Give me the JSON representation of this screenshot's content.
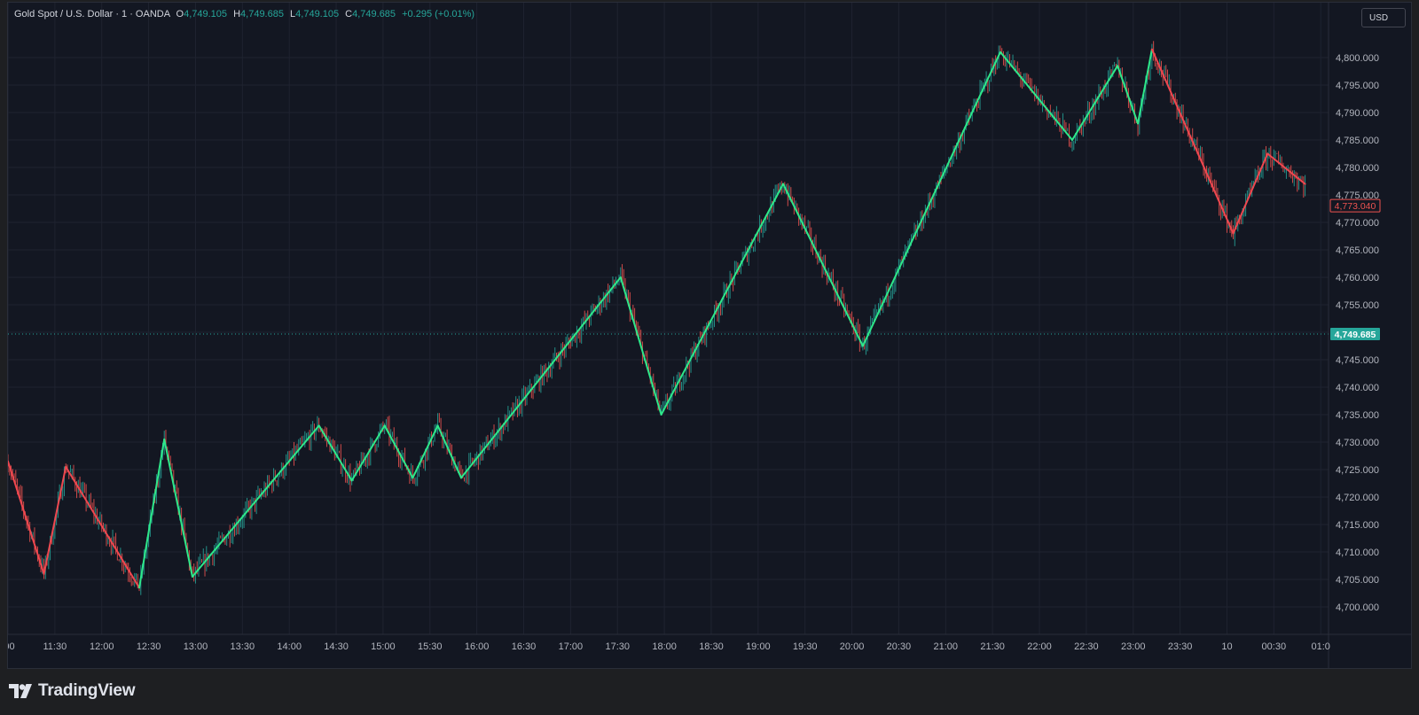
{
  "legend": {
    "symbol": "Gold Spot / U.S. Dollar · 1 · OANDA",
    "o_label": "O",
    "o_value": "4,749.105",
    "h_label": "H",
    "h_value": "4,749.685",
    "l_label": "L",
    "l_value": "4,749.105",
    "c_label": "C",
    "c_value": "4,749.685",
    "change": "+0.295 (+0.01%)"
  },
  "currency": "USD",
  "brand": {
    "name": "TradingView"
  },
  "colors": {
    "background": "#131722",
    "grid": "#1f2330",
    "up": "#26a69a",
    "down": "#ef5350",
    "zigzag_up": "#2ee88a",
    "zigzag_down": "#f0474f",
    "axis_text": "#b2b5be",
    "last_price_badge": "#26a69a",
    "marker_badge_border": "#ef5350"
  },
  "chart_data": {
    "type": "line",
    "ylim": [
      4695,
      4810
    ],
    "y_ticks": [
      "4,700.000",
      "4,705.000",
      "4,710.000",
      "4,715.000",
      "4,720.000",
      "4,725.000",
      "4,730.000",
      "4,735.000",
      "4,740.000",
      "4,745.000",
      "4,750.000",
      "4,755.000",
      "4,760.000",
      "4,765.000",
      "4,770.000",
      "4,775.000",
      "4,780.000",
      "4,785.000",
      "4,790.000",
      "4,795.000",
      "4,800.000"
    ],
    "y_tick_values": [
      4700,
      4705,
      4710,
      4715,
      4720,
      4725,
      4730,
      4735,
      4740,
      4745,
      4750,
      4755,
      4760,
      4765,
      4770,
      4775,
      4780,
      4785,
      4790,
      4795,
      4800
    ],
    "x_ticks": [
      ":00",
      "11:30",
      "12:00",
      "12:30",
      "13:00",
      "13:30",
      "14:00",
      "14:30",
      "15:00",
      "15:30",
      "16:00",
      "16:30",
      "17:00",
      "17:30",
      "18:00",
      "18:30",
      "19:00",
      "19:30",
      "20:00",
      "20:30",
      "21:00",
      "21:30",
      "22:00",
      "22:30",
      "23:00",
      "23:30",
      "10",
      "00:30",
      "01:0"
    ],
    "x_tick_minutes": [
      660,
      690,
      720,
      750,
      780,
      810,
      840,
      870,
      900,
      930,
      960,
      990,
      1020,
      1050,
      1080,
      1110,
      1140,
      1170,
      1200,
      1230,
      1260,
      1290,
      1320,
      1350,
      1380,
      1410,
      1440,
      1470,
      1500
    ],
    "xlim_minutes": [
      660,
      1505
    ],
    "zigzag": [
      {
        "t": 660,
        "p": 4726.5,
        "dir": "down"
      },
      {
        "t": 683,
        "p": 4706.0,
        "dir": "down"
      },
      {
        "t": 697,
        "p": 4725.5,
        "dir": "down"
      },
      {
        "t": 744,
        "p": 4703.5,
        "dir": "up"
      },
      {
        "t": 760,
        "p": 4730.5,
        "dir": "up"
      },
      {
        "t": 778,
        "p": 4705.5,
        "dir": "up"
      },
      {
        "t": 859,
        "p": 4733.0,
        "dir": "up"
      },
      {
        "t": 880,
        "p": 4723.0,
        "dir": "up"
      },
      {
        "t": 901,
        "p": 4733.0,
        "dir": "up"
      },
      {
        "t": 919,
        "p": 4723.5,
        "dir": "up"
      },
      {
        "t": 935,
        "p": 4733.0,
        "dir": "up"
      },
      {
        "t": 950,
        "p": 4723.5,
        "dir": "up"
      },
      {
        "t": 1052,
        "p": 4760.0,
        "dir": "up"
      },
      {
        "t": 1078,
        "p": 4735.0,
        "dir": "up"
      },
      {
        "t": 1156,
        "p": 4777.0,
        "dir": "up"
      },
      {
        "t": 1207,
        "p": 4747.5,
        "dir": "up"
      },
      {
        "t": 1295,
        "p": 4801.0,
        "dir": "up"
      },
      {
        "t": 1341,
        "p": 4785.0,
        "dir": "up"
      },
      {
        "t": 1370,
        "p": 4798.5,
        "dir": "up"
      },
      {
        "t": 1383,
        "p": 4788.0,
        "dir": "up"
      },
      {
        "t": 1392,
        "p": 4801.5,
        "dir": "down"
      },
      {
        "t": 1444,
        "p": 4768.0,
        "dir": "down"
      },
      {
        "t": 1466,
        "p": 4782.5,
        "dir": "down"
      },
      {
        "t": 1490,
        "p": 4777.0,
        "dir": "down"
      }
    ],
    "last_price": {
      "value": 4749.685,
      "label": "4,749.685"
    },
    "marker_price": {
      "value": 4773.04,
      "label": "4,773.040"
    }
  }
}
